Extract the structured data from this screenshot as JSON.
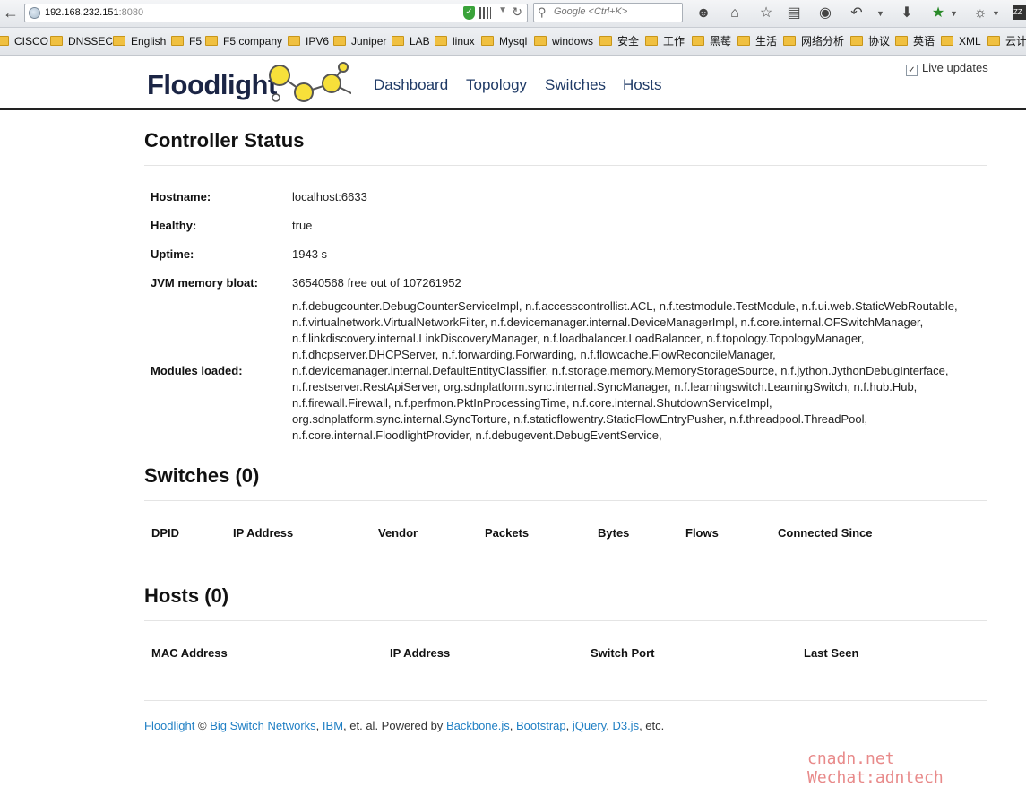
{
  "browser": {
    "url_host": "192.168.232.151",
    "url_port": ":8080",
    "search_placeholder": "Google <Ctrl+K>",
    "profile_badge": "ZZ",
    "bookmarks": [
      "CISCO",
      "DNSSEC",
      "English",
      "F5",
      "F5 company",
      "IPV6",
      "Juniper",
      "LAB",
      "linux",
      "Mysql",
      "windows",
      "安全",
      "工作",
      "黑莓",
      "生活",
      "网络分析",
      "协议",
      "英语",
      "XML",
      "云计"
    ]
  },
  "header": {
    "logo": "Floodlight",
    "nav": [
      "Dashboard",
      "Topology",
      "Switches",
      "Hosts"
    ],
    "live_updates_label": "Live updates",
    "live_updates_checked": true
  },
  "controller": {
    "title": "Controller Status",
    "hostname_label": "Hostname:",
    "hostname": "localhost:6633",
    "healthy_label": "Healthy:",
    "healthy": "true",
    "uptime_label": "Uptime:",
    "uptime": "1943 s",
    "jvm_label": "JVM memory bloat:",
    "jvm": "36540568 free out of 107261952",
    "modules_label": "Modules loaded:",
    "modules_lines": [
      "n.f.debugcounter.DebugCounterServiceImpl, n.f.accesscontrollist.ACL, n.f.testmodule.TestModule, n.f.ui.web.StaticWebRoutable,",
      "n.f.virtualnetwork.VirtualNetworkFilter, n.f.devicemanager.internal.DeviceManagerImpl, n.f.core.internal.OFSwitchManager,",
      "n.f.linkdiscovery.internal.LinkDiscoveryManager, n.f.loadbalancer.LoadBalancer, n.f.topology.TopologyManager,",
      "n.f.dhcpserver.DHCPServer, n.f.forwarding.Forwarding, n.f.flowcache.FlowReconcileManager,",
      "n.f.devicemanager.internal.DefaultEntityClassifier, n.f.storage.memory.MemoryStorageSource, n.f.jython.JythonDebugInterface,",
      "n.f.restserver.RestApiServer, org.sdnplatform.sync.internal.SyncManager, n.f.learningswitch.LearningSwitch, n.f.hub.Hub,",
      "n.f.firewall.Firewall, n.f.perfmon.PktInProcessingTime, n.f.core.internal.ShutdownServiceImpl,",
      "org.sdnplatform.sync.internal.SyncTorture, n.f.staticflowentry.StaticFlowEntryPusher, n.f.threadpool.ThreadPool,",
      "n.f.core.internal.FloodlightProvider, n.f.debugevent.DebugEventService,"
    ]
  },
  "switches": {
    "title": "Switches (0)",
    "columns": [
      "DPID",
      "IP Address",
      "Vendor",
      "Packets",
      "Bytes",
      "Flows",
      "Connected Since"
    ]
  },
  "hosts": {
    "title": "Hosts (0)",
    "columns": [
      "MAC Address",
      "IP Address",
      "Switch Port",
      "Last Seen"
    ]
  },
  "footer": {
    "link_floodlight": "Floodlight",
    "copyright": " © ",
    "link_bsn": "Big Switch Networks",
    "sep1": ", ",
    "link_ibm": "IBM",
    "text_powered": ", et. al. Powered by ",
    "link_backbone": "Backbone.js",
    "sep2": ", ",
    "link_bootstrap": "Bootstrap",
    "sep3": ", ",
    "link_jquery": "jQuery",
    "sep4": ", ",
    "link_d3": "D3.js",
    "text_etc": ", etc."
  },
  "watermark": "cnadn.net Wechat:adntech"
}
